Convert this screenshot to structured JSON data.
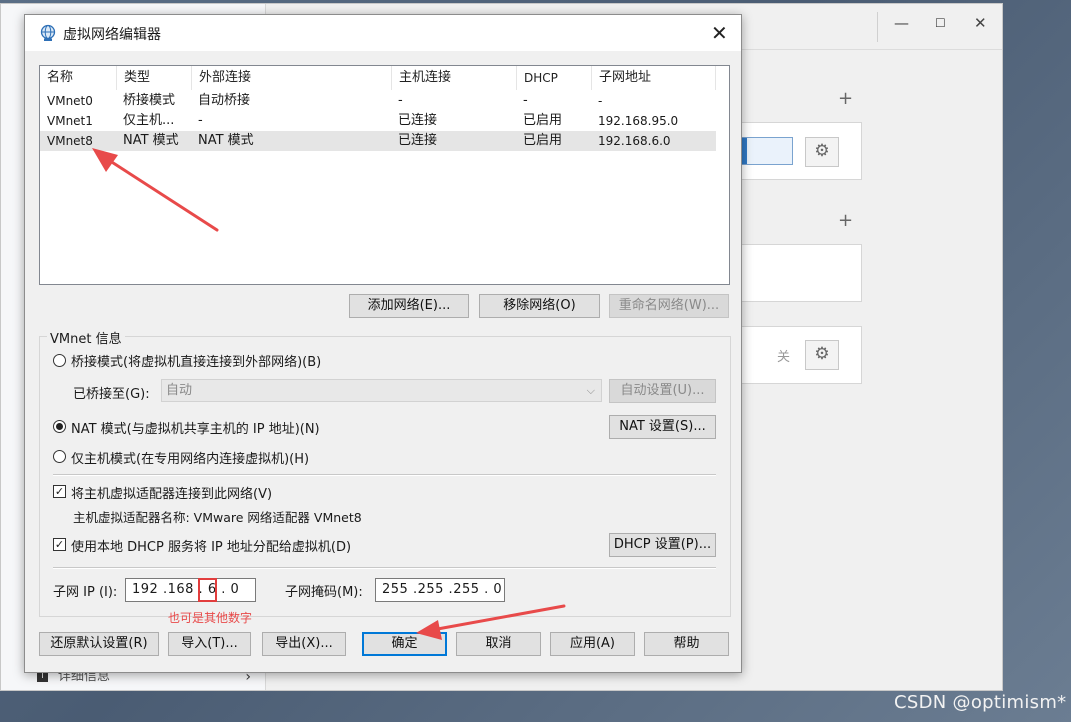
{
  "dialog": {
    "title": "虚拟网络编辑器",
    "close_glyph": "✕"
  },
  "table": {
    "headers": [
      "名称",
      "类型",
      "外部连接",
      "主机连接",
      "DHCP",
      "子网地址"
    ],
    "rows": [
      [
        "VMnet0",
        "桥接模式",
        "自动桥接",
        "-",
        "-",
        "-"
      ],
      [
        "VMnet1",
        "仅主机...",
        "-",
        "已连接",
        "已启用",
        "192.168.95.0"
      ],
      [
        "VMnet8",
        "NAT 模式",
        "NAT 模式",
        "已连接",
        "已启用",
        "192.168.6.0"
      ]
    ],
    "selected_row": 2
  },
  "list_buttons": {
    "add": "添加网络(E)...",
    "remove": "移除网络(O)",
    "rename": "重命名网络(W)..."
  },
  "vmnet_info": {
    "group_label": "VMnet 信息",
    "bridged_label": "桥接模式(将虚拟机直接连接到外部网络)(B)",
    "bridged_to_label": "已桥接至(G):",
    "bridged_to_value": "自动",
    "auto_settings": "自动设置(U)...",
    "nat_label": "NAT 模式(与虚拟机共享主机的 IP 地址)(N)",
    "nat_settings": "NAT 设置(S)...",
    "hostonly_label": "仅主机模式(在专用网络内连接虚拟机)(H)",
    "selected_mode": "nat",
    "connect_adapter_label": "将主机虚拟适配器连接到此网络(V)",
    "connect_adapter_checked": true,
    "adapter_name_label": "主机虚拟适配器名称: VMware 网络适配器 VMnet8",
    "dhcp_label": "使用本地 DHCP 服务将 IP 地址分配给虚拟机(D)",
    "dhcp_checked": true,
    "dhcp_settings": "DHCP 设置(P)...",
    "subnet_ip_label": "子网 IP (I):",
    "subnet_ip": [
      "192",
      "168",
      "6",
      "0"
    ],
    "subnet_mask_label": "子网掩码(M):",
    "subnet_mask": [
      "255",
      "255",
      "255",
      "0"
    ]
  },
  "annotation_note": "也可是其他数字",
  "bottom_buttons": {
    "restore": "还原默认设置(R)",
    "import": "导入(T)...",
    "export": "导出(X)...",
    "ok": "确定",
    "cancel": "取消",
    "apply": "应用(A)",
    "help": "帮助"
  },
  "background": {
    "sidebar_bottom_item": "详细信息",
    "off_label": "关"
  },
  "watermark": "CSDN @optimism*",
  "colors": {
    "annotation_red": "#e84a4a",
    "default_button_border": "#0078d7"
  }
}
